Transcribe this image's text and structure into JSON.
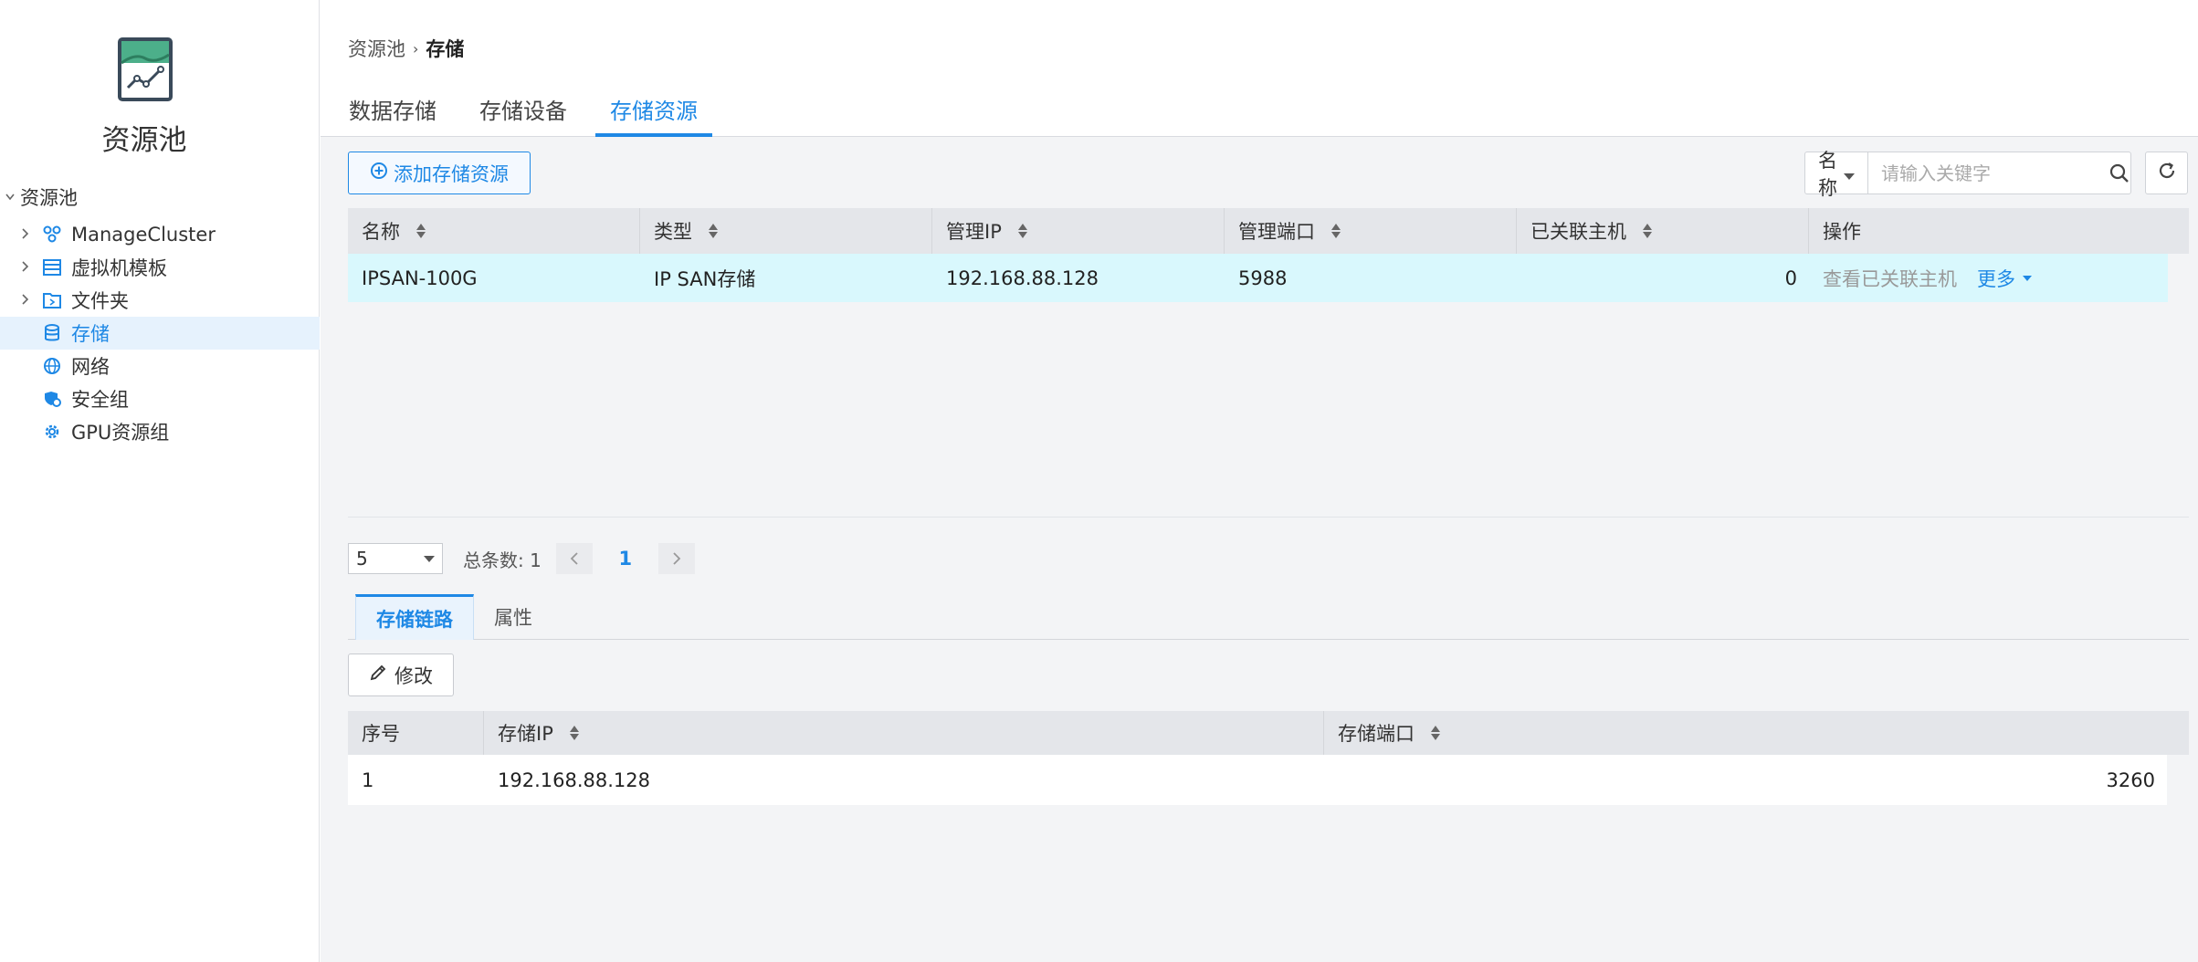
{
  "sidebar": {
    "title": "资源池",
    "root": "资源池",
    "items": [
      {
        "label": "ManageCluster",
        "icon": "cluster-icon",
        "expandable": true
      },
      {
        "label": "虚拟机模板",
        "icon": "template-icon",
        "expandable": true
      },
      {
        "label": "文件夹",
        "icon": "folder-icon",
        "expandable": true
      },
      {
        "label": "存储",
        "icon": "storage-icon",
        "expandable": false,
        "active": true
      },
      {
        "label": "网络",
        "icon": "globe-icon",
        "expandable": false
      },
      {
        "label": "安全组",
        "icon": "security-group-icon",
        "expandable": false
      },
      {
        "label": "GPU资源组",
        "icon": "gpu-icon",
        "expandable": false
      }
    ]
  },
  "header": {
    "breadcrumb": [
      "资源池",
      "存储"
    ],
    "tabs": [
      "数据存储",
      "存储设备",
      "存储资源"
    ],
    "active_tab": 2
  },
  "toolbar": {
    "add_label": "添加存储资源",
    "search_field": "名称",
    "search_placeholder": "请输入关键字"
  },
  "table": {
    "columns": [
      "名称",
      "类型",
      "管理IP",
      "管理端口",
      "已关联主机",
      "操作"
    ],
    "rows": [
      {
        "name": "IPSAN-100G",
        "type": "IP SAN存储",
        "ip": "192.168.88.128",
        "port": "5988",
        "hosts": "0",
        "action_view": "查看已关联主机",
        "action_more": "更多"
      }
    ]
  },
  "pager": {
    "page_size": "5",
    "total": "总条数: 1",
    "current": "1"
  },
  "detail": {
    "tabs": [
      "存储链路",
      "属性"
    ],
    "edit_label": "修改",
    "columns": [
      "序号",
      "存储IP",
      "存储端口"
    ],
    "rows": [
      {
        "no": "1",
        "ip": "192.168.88.128",
        "port": "3260"
      }
    ]
  },
  "colors": {
    "accent": "#1e88e5",
    "selected_row": "#d9f8fd",
    "logo_green": "#4caf8a"
  }
}
